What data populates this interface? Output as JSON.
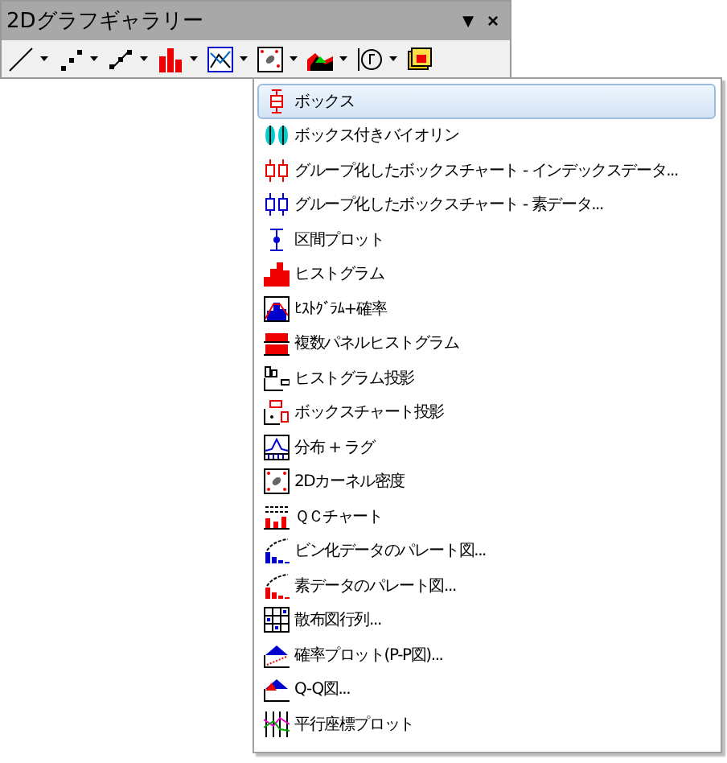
{
  "panel": {
    "title": "2Dグラフギャラリー",
    "menu_button": "▼",
    "close_button": "×"
  },
  "toolbar": [
    {
      "dropdown": true
    },
    {
      "dropdown": true
    },
    {
      "dropdown": true
    },
    {
      "dropdown": true
    },
    {
      "dropdown": true
    },
    {
      "dropdown": true
    },
    {
      "dropdown": true
    },
    {
      "dropdown": true
    },
    {
      "dropdown": false
    }
  ],
  "menu": [
    {
      "label": "ボックス",
      "selected": true
    },
    {
      "label": "ボックス付きバイオリン",
      "selected": false
    },
    {
      "label": "グループ化したボックスチャート - インデックスデータ...",
      "selected": false
    },
    {
      "label": "グループ化したボックスチャート - 素データ...",
      "selected": false
    },
    {
      "label": "区間プロット",
      "selected": false
    },
    {
      "label": "ヒストグラム",
      "selected": false
    },
    {
      "label": "ﾋｽﾄｸﾞﾗﾑ+確率",
      "selected": false
    },
    {
      "label": "複数パネルヒストグラム",
      "selected": false
    },
    {
      "label": "ヒストグラム投影",
      "selected": false
    },
    {
      "label": "ボックスチャート投影",
      "selected": false
    },
    {
      "label": "分布 + ラグ",
      "selected": false
    },
    {
      "label": "2Dカーネル密度",
      "selected": false
    },
    {
      "label": "ＱＣチャート",
      "selected": false
    },
    {
      "label": "ビン化データのパレート図...",
      "selected": false
    },
    {
      "label": "素データのパレート図...",
      "selected": false
    },
    {
      "label": "散布図行列...",
      "selected": false
    },
    {
      "label": "確率プロット(P-P図)...",
      "selected": false
    },
    {
      "label": "Q-Q図...",
      "selected": false
    },
    {
      "label": "平行座標プロット",
      "selected": false
    }
  ]
}
